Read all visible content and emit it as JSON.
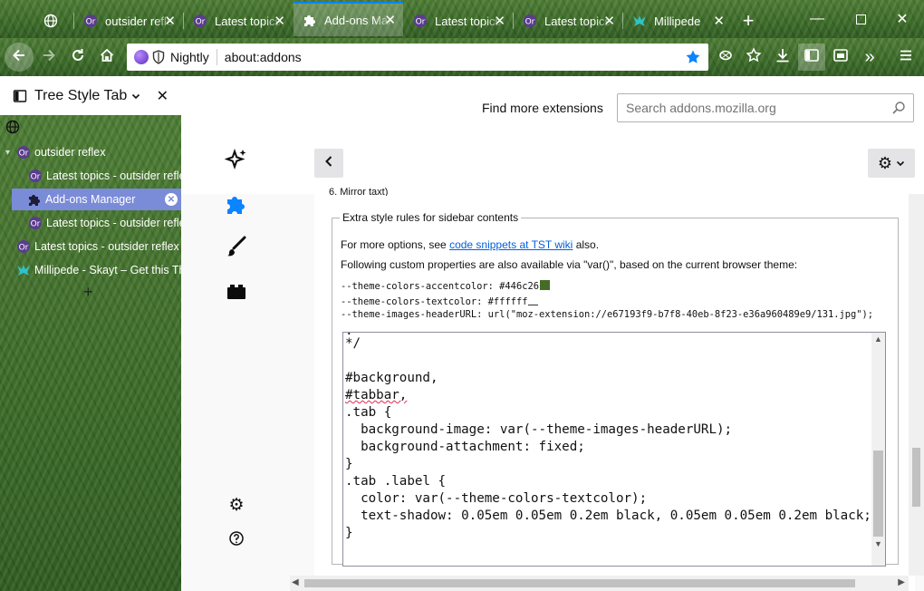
{
  "colors": {
    "accent": "#0a84ff",
    "tree_selected": "#7a8bd8",
    "link": "#0060df",
    "swatch": "#446c26"
  },
  "tabs": [
    {
      "label": "outsider reflex",
      "icon": "openrpg-icon"
    },
    {
      "label": "Latest topics",
      "icon": "openrpg-icon"
    },
    {
      "label": "Add-ons Manager",
      "icon": "puzzle-icon",
      "active": true
    },
    {
      "label": "Latest topics",
      "icon": "openrpg-icon"
    },
    {
      "label": "Latest topics",
      "icon": "openrpg-icon"
    },
    {
      "label": "Millipede",
      "icon": "millipede-icon"
    }
  ],
  "browser": {
    "identity": "Nightly",
    "url": "about:addons"
  },
  "sidebar": {
    "title": "Tree Style Tab",
    "tree": [
      {
        "label": "outsider reflex",
        "icon": "openrpg-icon",
        "level": 0,
        "twisty": "▾"
      },
      {
        "label": "Latest topics - outsider reflex",
        "icon": "openrpg-icon",
        "level": 1
      },
      {
        "label": "Add-ons Manager",
        "icon": "puzzle-icon",
        "level": 1,
        "selected": true
      },
      {
        "label": "Latest topics - outsider reflex",
        "icon": "openrpg-icon",
        "level": 1
      },
      {
        "label": "Latest topics - outsider reflex",
        "icon": "openrpg-icon",
        "level": 0
      },
      {
        "label": "Millipede - Skayt – Get this Theme",
        "icon": "millipede-icon",
        "level": 0
      }
    ],
    "new_tab": "+"
  },
  "addons": {
    "find_more": "Find more extensions",
    "search_placeholder": "Search addons.mozilla.org",
    "clipped_text": "6. Mirror taxt)",
    "fieldset_legend": "Extra style rules for sidebar contents",
    "options_prefix": "For more options, see ",
    "options_link": "code snippets at TST wiki",
    "options_suffix": " also.",
    "properties_text": "Following custom properties are also available via \"var()\", based on the current browser theme:",
    "props": [
      {
        "name": "--theme-colors-accentcolor:",
        "value": "#446c26"
      },
      {
        "name": "--theme-colors-textcolor:",
        "value": "#ffffff"
      },
      {
        "name": "--theme-images-headerURL:",
        "value": "url(\"moz-extension://e67193f9-b7f8-40eb-8f23-e36a960489e9/131.jpg\");"
      }
    ],
    "css_lines": [
      "*/",
      "",
      "#background,",
      "#tabbar,",
      ".tab {",
      "  background-image: var(--theme-images-headerURL);",
      "  background-attachment: fixed;",
      "}",
      ".tab .label {",
      "  color: var(--theme-colors-textcolor);",
      "  text-shadow: 0.05em 0.05em 0.2em black, 0.05em 0.05em 0.2em black;",
      "}"
    ]
  }
}
